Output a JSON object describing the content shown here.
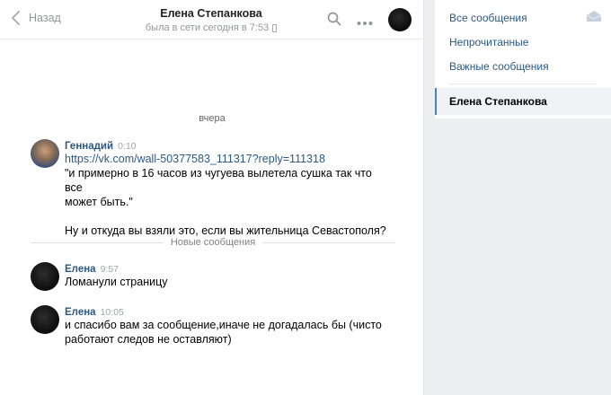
{
  "header": {
    "back_label": "Назад",
    "peer_name": "Елена Степанкова",
    "peer_status": "была в сети сегодня в 7:53",
    "icons": [
      "chevron-left-icon",
      "search-icon",
      "more-icon",
      "phone-icon"
    ]
  },
  "conversation": {
    "day_label": "вчера",
    "new_messages_label": "Новые сообщения",
    "messages": [
      {
        "author": "Геннадий",
        "time": "0:10",
        "link": "https://vk.com/wall-50377583_111317?reply=111318",
        "lines": [
          "\"и примерно в 16 часов из чугуева вылетела сушка так что все",
          "может быть.\"",
          "",
          "Ну и откуда вы взяли это, если вы жительница Севастополя?"
        ]
      },
      {
        "author": "Елена",
        "time": "9:57",
        "lines": [
          "Ломанули страницу"
        ]
      },
      {
        "author": "Елена",
        "time": "10:05",
        "lines": [
          "и спасибо вам за сообщение,иначе не догадалась бы (чисто",
          "работают следов не оставляют)"
        ]
      }
    ]
  },
  "sidebar": {
    "items": [
      {
        "label": "Все сообщения"
      },
      {
        "label": "Непрочитанные"
      },
      {
        "label": "Важные сообщения"
      }
    ],
    "active_dialog": "Елена Степанкова",
    "icon": "mail-icon"
  },
  "colors": {
    "link": "#2a5885",
    "muted": "#939699",
    "accent": "#5181b8",
    "background": "#edeef0"
  }
}
